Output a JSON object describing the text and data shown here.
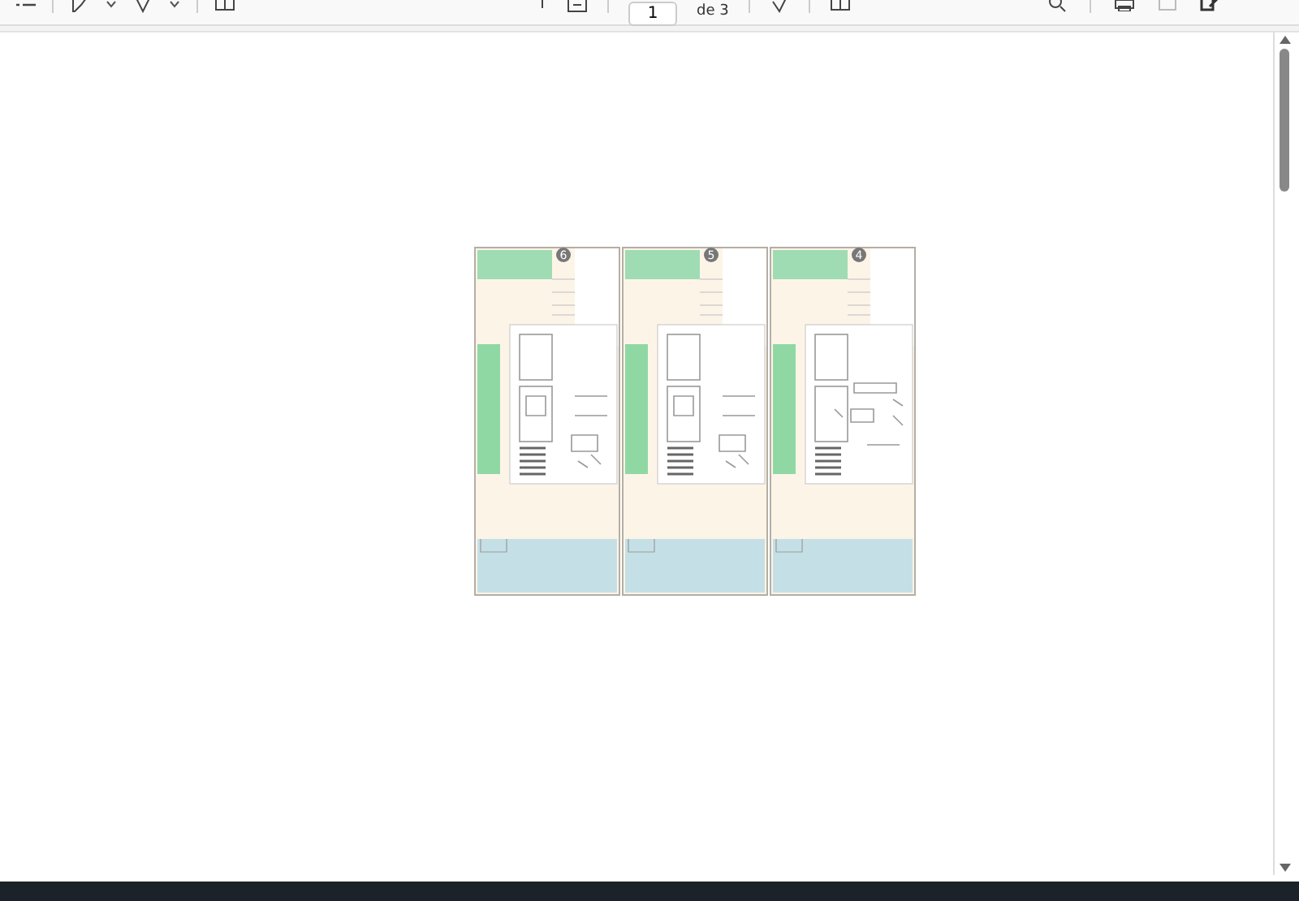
{
  "toolbar": {
    "page_field": {
      "value": "1"
    },
    "page_count": "de 3"
  },
  "floor_plan": {
    "units": [
      {
        "number": "6",
        "kind": "bedroom"
      },
      {
        "number": "5",
        "kind": "bedroom"
      },
      {
        "number": "4",
        "kind": "living"
      }
    ]
  }
}
